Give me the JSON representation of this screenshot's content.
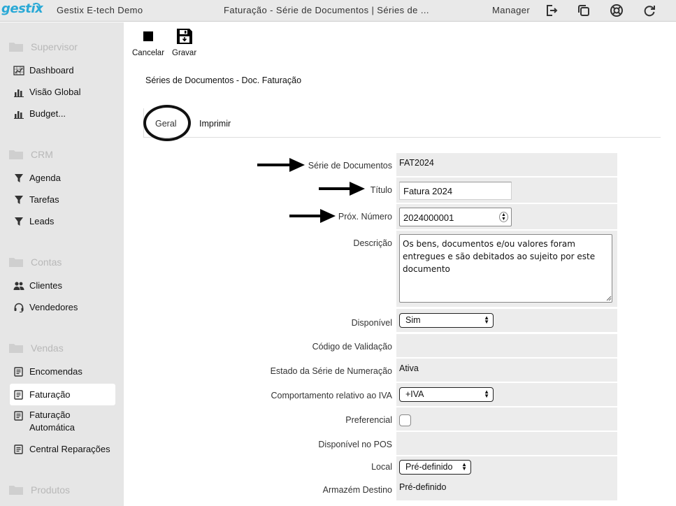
{
  "topbar": {
    "logo": "gestix",
    "app_name": "Gestix E-tech Demo",
    "window_title": "Faturação - Série de Documentos | Séries de ...",
    "user": "Manager",
    "icons": [
      "logout-icon",
      "window-icon",
      "help-lifebuoy-icon",
      "refresh-icon"
    ]
  },
  "sidebar": {
    "sections": [
      {
        "label": "Supervisor",
        "items": [
          {
            "label": "Dashboard",
            "icon": "dashboard-icon"
          },
          {
            "label": "Visão Global",
            "icon": "bar-chart-icon"
          },
          {
            "label": "Budget...",
            "icon": "bar-chart-icon"
          }
        ]
      },
      {
        "label": "CRM",
        "items": [
          {
            "label": "Agenda",
            "icon": "funnel-icon"
          },
          {
            "label": "Tarefas",
            "icon": "funnel-icon"
          },
          {
            "label": "Leads",
            "icon": "funnel-icon"
          }
        ]
      },
      {
        "label": "Contas",
        "items": [
          {
            "label": "Clientes",
            "icon": "users-icon"
          },
          {
            "label": "Vendedores",
            "icon": "headset-icon"
          }
        ]
      },
      {
        "label": "Vendas",
        "items": [
          {
            "label": "Encomendas",
            "icon": "document-icon"
          },
          {
            "label": "Faturação",
            "icon": "document-icon",
            "active": true
          },
          {
            "label": "Faturação Automática",
            "icon": "document-icon"
          },
          {
            "label": "Central Reparações",
            "icon": "document-icon"
          }
        ]
      },
      {
        "label": "Produtos",
        "items": []
      }
    ]
  },
  "toolbar": {
    "cancel_label": "Cancelar",
    "save_label": "Gravar"
  },
  "page": {
    "title": "Séries de Documentos - Doc. Faturação"
  },
  "tabs": [
    {
      "label": "Geral",
      "active": true
    },
    {
      "label": "Imprimir",
      "active": false
    }
  ],
  "form": {
    "serie_label": "Série de Documentos",
    "serie_value": "FAT2024",
    "titulo_label": "Título",
    "titulo_value": "Fatura 2024",
    "prox_label": "Próx. Número",
    "prox_value": "2024000001",
    "descricao_label": "Descrição",
    "descricao_value": "Os bens, documentos e/ou valores foram entregues e são debitados ao sujeito por este documento",
    "disponivel_label": "Disponível",
    "disponivel_value": "Sim",
    "codigo_label": "Código de Validação",
    "codigo_value": "",
    "estado_label": "Estado da Série de Numeração",
    "estado_value": "Ativa",
    "iva_label": "Comportamento relativo ao IVA",
    "iva_value": "+IVA",
    "preferencial_label": "Preferencial",
    "preferencial_checked": false,
    "pos_label": "Disponível no POS",
    "pos_value": "",
    "local_label": "Local",
    "local_value": "Pré-definido",
    "armazem_label": "Armazém Destino",
    "armazem_value": "Pré-definido"
  }
}
